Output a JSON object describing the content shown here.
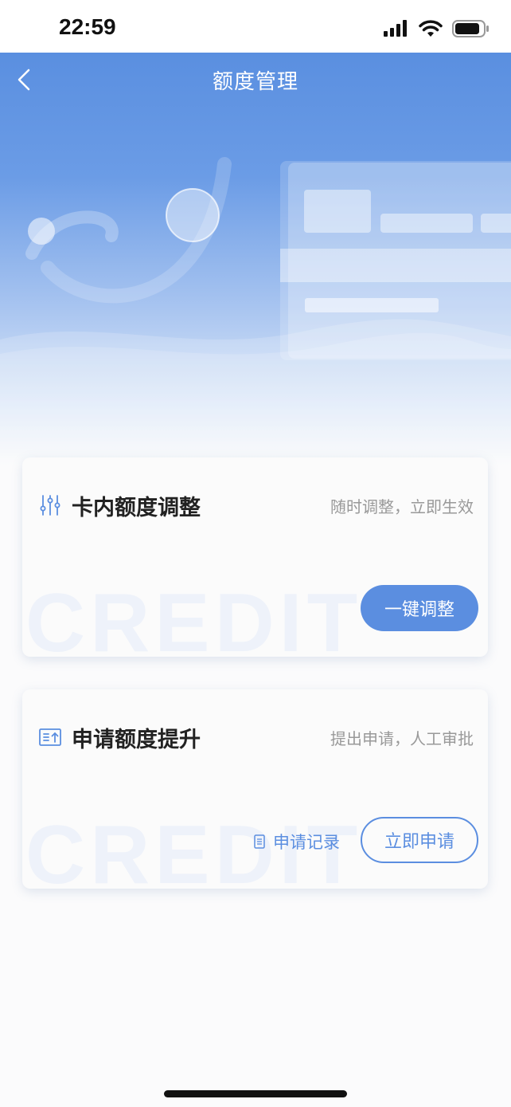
{
  "status_bar": {
    "time": "22:59"
  },
  "header": {
    "title": "额度管理"
  },
  "cards": [
    {
      "title": "卡内额度调整",
      "subtitle": "随时调整，立即生效",
      "primary_button": "一键调整",
      "watermark": "CREDIT"
    },
    {
      "title": "申请额度提升",
      "subtitle": "提出申请，人工审批",
      "link": "申请记录",
      "primary_button": "立即申请",
      "watermark": "CREDIT"
    }
  ],
  "colors": {
    "accent": "#5b8ee0",
    "hero_top": "#5a8fe0"
  },
  "icons": [
    "back-icon",
    "signal-icon",
    "wifi-icon",
    "battery-icon",
    "sliders-icon",
    "upgrade-icon",
    "document-icon"
  ]
}
